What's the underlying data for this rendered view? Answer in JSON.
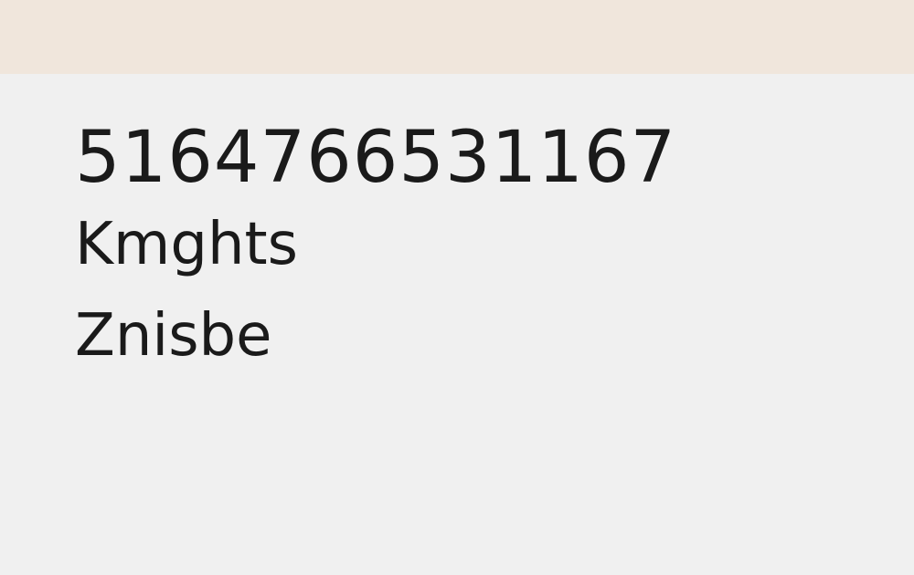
{
  "header": {
    "background_color": "#f0e6dc"
  },
  "content": {
    "number": "5164766531167",
    "lines": [
      "Kmghts",
      "Znisbe"
    ]
  },
  "colors": {
    "page_background": "#f0f0f0",
    "text": "#1a1a1a"
  }
}
